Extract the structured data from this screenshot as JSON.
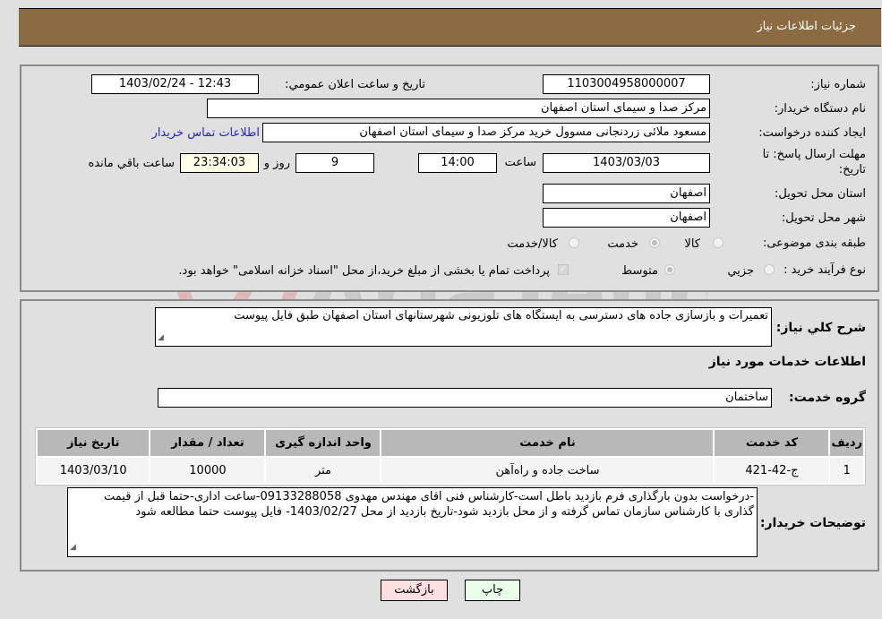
{
  "header": {
    "title": "جزئیات اطلاعات نیاز"
  },
  "details": {
    "need_number_label": "شماره نیاز:",
    "need_number": "1103004958000007",
    "announce_label": "تاریخ و ساعت اعلان عمومي:",
    "announce_value": "1403/02/24 - 12:43",
    "buyer_org_label": "نام دستگاه خریدار:",
    "buyer_org": "مرکز صدا و سیمای استان اصفهان",
    "creator_label": "ایجاد کننده درخواست:",
    "creator": "مسعود ملائی زردنجانی مسوول خرید مرکز صدا و سیمای استان اصفهان",
    "contact_link": "اطلاعات تماس خریدار",
    "deadline_label_line1": "مهلت ارسال پاسخ: تا",
    "deadline_label_line2": "تاریخ:",
    "deadline_date": "1403/03/03",
    "time_label": "ساعت",
    "deadline_time": "14:00",
    "days_value": "9",
    "days_label": "روز و",
    "remaining_time": "23:34:03",
    "remaining_label": "ساعت باقي مانده",
    "province_label": "استان محل تحویل:",
    "province": "اصفهان",
    "city_label": "شهر محل تحویل:",
    "city": "اصفهان",
    "category_label": "طبقه بندی موضوعی:",
    "category_options": [
      {
        "label": "کالا",
        "selected": false
      },
      {
        "label": "خدمت",
        "selected": true
      },
      {
        "label": "کالا/خدمت",
        "selected": false
      }
    ],
    "process_label": "نوع فرآیند خرید :",
    "process_options": [
      {
        "label": "جزيي",
        "selected": false
      },
      {
        "label": "متوسط",
        "selected": true
      }
    ],
    "treasury_checked": true,
    "treasury_text": "پرداخت تمام یا بخشی از مبلغ خرید،از محل \"اسناد خزانه اسلامی\" خواهد بود."
  },
  "description": {
    "label": "شرح كلي نياز:",
    "value": "تعمیرات و بازسازی جاده های دسترسی به ایستگاه های تلوزیونی شهرستانهای استان اصفهان طبق فایل پیوست"
  },
  "services": {
    "section_title": "اطلاعات خدمات مورد نیاز",
    "group_label": "گروه خدمت:",
    "group_value": "ساختمان",
    "columns": [
      "ردیف",
      "کد خدمت",
      "نام خدمت",
      "واحد اندازه گیری",
      "تعداد / مقدار",
      "تاریخ نیاز"
    ],
    "rows": [
      {
        "index": "1",
        "code": "ج-42-421",
        "name": "ساخت جاده و راه‌آهن",
        "unit": "متر",
        "quantity": "10000",
        "date": "1403/03/10"
      }
    ]
  },
  "buyer_notes": {
    "label": "توضیحات خریدار:",
    "value": "-درخواست بدون بارگذاری فرم بازدید باطل است-کارشناس فنی اقای مهندس مهدوی 09133288058-ساعت اداری-حتما قبل از قیمت گذاری با کارشناس سازمان تماس گرفته و از محل بازدید شود-تاریخ بازدید از محل 1403/02/27- فایل پیوست حتما مطالعه شود"
  },
  "buttons": {
    "print": "چاپ",
    "back": "بازگشت"
  },
  "watermark": {
    "text": "AriaTender.neT",
    "color": "#d9a0a0"
  }
}
